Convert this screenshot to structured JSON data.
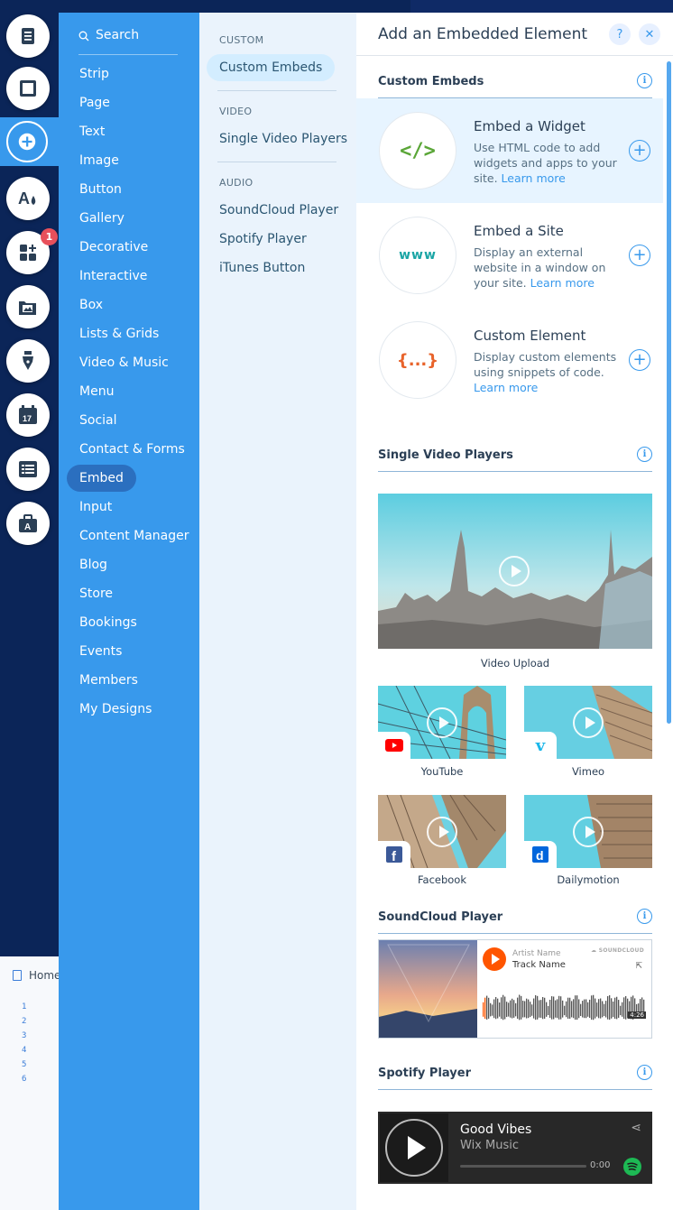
{
  "background": {
    "page_label": "Home",
    "ruler_numbers": [
      "1",
      "2",
      "3",
      "4",
      "5",
      "6"
    ]
  },
  "rail": {
    "badge_count": "1",
    "icons": [
      "pages-icon",
      "strip-icon",
      "add-icon",
      "theme-icon",
      "apps-icon",
      "media-icon",
      "pen-icon",
      "calendar-icon",
      "table-icon",
      "business-icon"
    ]
  },
  "categories": {
    "search_label": "Search",
    "items": [
      "Strip",
      "Page",
      "Text",
      "Image",
      "Button",
      "Gallery",
      "Decorative",
      "Interactive",
      "Box",
      "Lists & Grids",
      "Video & Music",
      "Menu",
      "Social",
      "Contact & Forms",
      "Embed",
      "Input",
      "Content Manager",
      "Blog",
      "Store",
      "Bookings",
      "Events",
      "Members",
      "My Designs"
    ],
    "selected": "Embed"
  },
  "subcategories": {
    "custom_heading": "CUSTOM",
    "custom_items": [
      "Custom Embeds"
    ],
    "video_heading": "VIDEO",
    "video_items": [
      "Single Video Players"
    ],
    "audio_heading": "AUDIO",
    "audio_items": [
      "SoundCloud Player",
      "Spotify Player",
      "iTunes Button"
    ],
    "selected": "Custom Embeds"
  },
  "panel": {
    "title": "Add an Embedded Element",
    "help_label": "?",
    "close_label": "✕",
    "info_label": "i",
    "plus_label": "+",
    "custom_embeds": {
      "heading": "Custom Embeds",
      "items": [
        {
          "title": "Embed a Widget",
          "desc": "Use HTML code to add widgets and apps to your site.",
          "link": "Learn more",
          "glyph": "</>",
          "color": "#5aa637"
        },
        {
          "title": "Embed a Site",
          "desc": "Display an external website in a window on your site.",
          "link": "Learn more",
          "glyph": "www",
          "color": "#1aa5a5"
        },
        {
          "title": "Custom Element",
          "desc": "Display custom elements using snippets of code.",
          "link": "Learn more",
          "glyph": "{...}",
          "color": "#e8632b"
        }
      ]
    },
    "video": {
      "heading": "Single Video Players",
      "main_caption": "Video Upload",
      "tiles": [
        {
          "caption": "YouTube",
          "logo": "youtube-logo",
          "logo_color": "#ff0000"
        },
        {
          "caption": "Vimeo",
          "logo": "vimeo-logo",
          "logo_color": "#1ab7ea"
        },
        {
          "caption": "Facebook",
          "logo": "facebook-logo",
          "logo_color": "#3b5998"
        },
        {
          "caption": "Dailymotion",
          "logo": "dailymotion-logo",
          "logo_color": "#0066dc"
        }
      ]
    },
    "soundcloud": {
      "heading": "SoundCloud Player",
      "artist": "Artist Name",
      "track": "Track Name",
      "brand": "SOUNDCLOUD",
      "duration": "4:26",
      "accent": "#ff5500"
    },
    "spotify": {
      "heading": "Spotify Player",
      "title": "Good Vibes",
      "artist": "Wix Music",
      "time": "0:00",
      "accent": "#1db954"
    }
  }
}
